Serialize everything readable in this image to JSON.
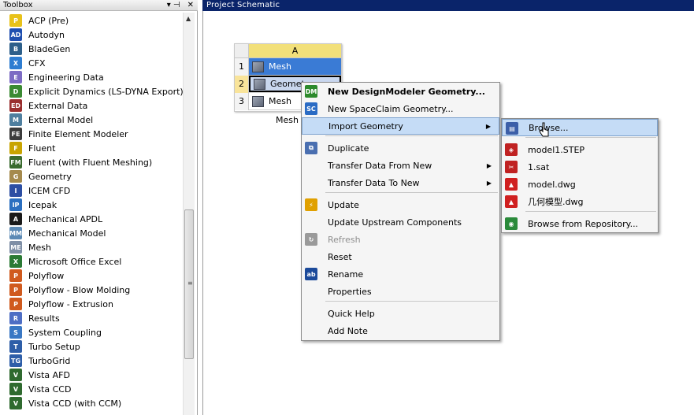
{
  "toolbox": {
    "title": "Toolbox",
    "pin": "▾ ⊣",
    "close": "✕",
    "items": [
      {
        "label": "ACP (Pre)",
        "icon": "acp-icon",
        "color": "#e8c21a",
        "glyph": "P"
      },
      {
        "label": "Autodyn",
        "icon": "autodyn-icon",
        "color": "#1f4fb0",
        "glyph": "AD"
      },
      {
        "label": "BladeGen",
        "icon": "bladegen-icon",
        "color": "#2d5f8a",
        "glyph": "B"
      },
      {
        "label": "CFX",
        "icon": "cfx-icon",
        "color": "#2e7dd1",
        "glyph": "X"
      },
      {
        "label": "Engineering Data",
        "icon": "engineering-data-icon",
        "color": "#7d6cc4",
        "glyph": "E"
      },
      {
        "label": "Explicit Dynamics (LS-DYNA Export)",
        "icon": "explicit-dynamics-icon",
        "color": "#3b8a33",
        "glyph": "D"
      },
      {
        "label": "External Data",
        "icon": "external-data-icon",
        "color": "#9a2f2f",
        "glyph": "ED"
      },
      {
        "label": "External Model",
        "icon": "external-model-icon",
        "color": "#4f7f9f",
        "glyph": "M"
      },
      {
        "label": "Finite Element Modeler",
        "icon": "finite-element-modeler-icon",
        "color": "#3c3c3c",
        "glyph": "FE"
      },
      {
        "label": "Fluent",
        "icon": "fluent-icon",
        "color": "#c8a400",
        "glyph": "F"
      },
      {
        "label": "Fluent (with Fluent Meshing)",
        "icon": "fluent-meshing-icon",
        "color": "#3a6b2f",
        "glyph": "FM"
      },
      {
        "label": "Geometry",
        "icon": "geometry-icon",
        "color": "#a58a4d",
        "glyph": "G"
      },
      {
        "label": "ICEM CFD",
        "icon": "icem-cfd-icon",
        "color": "#2c4ea3",
        "glyph": "I"
      },
      {
        "label": "Icepak",
        "icon": "icepak-icon",
        "color": "#2b6fc0",
        "glyph": "IP"
      },
      {
        "label": "Mechanical APDL",
        "icon": "mechanical-apdl-icon",
        "color": "#1a1a1a",
        "glyph": "A"
      },
      {
        "label": "Mechanical Model",
        "icon": "mechanical-model-icon",
        "color": "#5c8ab5",
        "glyph": "MM"
      },
      {
        "label": "Mesh",
        "icon": "mesh-icon",
        "color": "#7f8fa6",
        "glyph": "ME"
      },
      {
        "label": "Microsoft Office Excel",
        "icon": "excel-icon",
        "color": "#2b7a35",
        "glyph": "X"
      },
      {
        "label": "Polyflow",
        "icon": "polyflow-icon",
        "color": "#d05a1e",
        "glyph": "P"
      },
      {
        "label": "Polyflow - Blow Molding",
        "icon": "polyflow-blow-molding-icon",
        "color": "#d05a1e",
        "glyph": "P"
      },
      {
        "label": "Polyflow - Extrusion",
        "icon": "polyflow-extrusion-icon",
        "color": "#d05a1e",
        "glyph": "P"
      },
      {
        "label": "Results",
        "icon": "results-icon",
        "color": "#4e6ec4",
        "glyph": "R"
      },
      {
        "label": "System Coupling",
        "icon": "system-coupling-icon",
        "color": "#3a78c4",
        "glyph": "S"
      },
      {
        "label": "Turbo Setup",
        "icon": "turbo-setup-icon",
        "color": "#2e5ea8",
        "glyph": "T"
      },
      {
        "label": "TurboGrid",
        "icon": "turbogrid-icon",
        "color": "#2e5ea8",
        "glyph": "TG"
      },
      {
        "label": "Vista AFD",
        "icon": "vista-afd-icon",
        "color": "#2f6a2f",
        "glyph": "V"
      },
      {
        "label": "Vista CCD",
        "icon": "vista-ccd-icon",
        "color": "#2f6a2f",
        "glyph": "V"
      },
      {
        "label": "Vista CCD (with CCM)",
        "icon": "vista-ccd-ccm-icon",
        "color": "#2f6a2f",
        "glyph": "V"
      }
    ]
  },
  "schematic": {
    "title": "Project Schematic",
    "system": {
      "column": "A",
      "rows": [
        {
          "num": "1",
          "label": "Mesh"
        },
        {
          "num": "2",
          "label": "Geometry"
        },
        {
          "num": "3",
          "label": "Mesh"
        }
      ],
      "caption": "Mesh"
    }
  },
  "context_menu": {
    "items": [
      {
        "label": "New DesignModeler Geometry...",
        "icon": "designmodeler-icon",
        "glyph": "DM",
        "color": "#2c8a2c",
        "bold": true
      },
      {
        "label": "New SpaceClaim Geometry...",
        "icon": "spaceclaim-icon",
        "glyph": "SC",
        "color": "#2a6bc4"
      },
      {
        "label": "Import Geometry",
        "arrow": "▶",
        "active": true
      },
      {
        "label": "Duplicate",
        "icon": "duplicate-icon",
        "glyph": "⧉",
        "color": "#4a6fb0"
      },
      {
        "label": "Transfer Data From New",
        "arrow": "▶"
      },
      {
        "label": "Transfer Data To New",
        "arrow": "▶"
      },
      {
        "label": "Update",
        "icon": "update-icon",
        "glyph": "⚡",
        "color": "#e0a000"
      },
      {
        "label": "Update Upstream Components"
      },
      {
        "label": "Refresh",
        "icon": "refresh-icon",
        "glyph": "↻",
        "color": "#9a9a9a",
        "disabled": true
      },
      {
        "label": "Reset"
      },
      {
        "label": "Rename",
        "icon": "rename-icon",
        "glyph": "ab",
        "color": "#1c4a9a"
      },
      {
        "label": "Properties"
      },
      {
        "label": "Quick Help"
      },
      {
        "label": "Add Note"
      }
    ]
  },
  "submenu": {
    "items": [
      {
        "label": "Browse...",
        "icon": "browse-icon",
        "glyph": "▤",
        "color": "#3c5fa8",
        "active": true
      },
      {
        "label": "model1.STEP",
        "icon": "step-file-icon",
        "glyph": "◈",
        "color": "#c02222"
      },
      {
        "label": "1.sat",
        "icon": "sat-file-icon",
        "glyph": "✂",
        "color": "#c02222"
      },
      {
        "label": "model.dwg",
        "icon": "dwg-file-icon",
        "glyph": "▲",
        "color": "#d02020"
      },
      {
        "label": "几何模型.dwg",
        "icon": "dwg-file-icon",
        "glyph": "▲",
        "color": "#d02020"
      },
      {
        "label": "Browse from Repository...",
        "icon": "repository-icon",
        "glyph": "◉",
        "color": "#2a8a3a"
      }
    ]
  }
}
